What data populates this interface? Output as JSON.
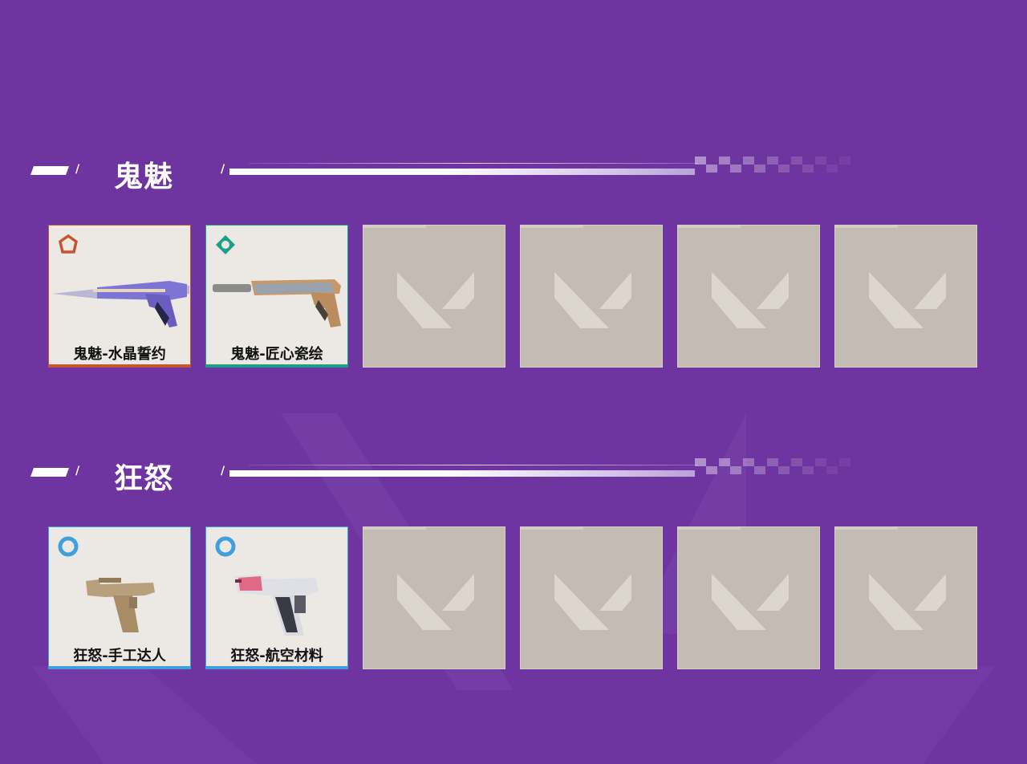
{
  "colors": {
    "background": "#6e35a0",
    "legendary": "#c8532f",
    "premium": "#1d9f87",
    "select": "#3ea1dd"
  },
  "sections": [
    {
      "title": "鬼魅",
      "items": [
        {
          "label": "鬼魅-水晶誓约",
          "rarity": "legendary-icon"
        },
        {
          "label": "鬼魅-匠心瓷绘",
          "rarity": "premium-icon"
        }
      ],
      "empty_slots": 4
    },
    {
      "title": "狂怒",
      "items": [
        {
          "label": "狂怒-手工达人",
          "rarity": "select-icon"
        },
        {
          "label": "狂怒-航空材料",
          "rarity": "select-icon"
        }
      ],
      "empty_slots": 4
    }
  ]
}
